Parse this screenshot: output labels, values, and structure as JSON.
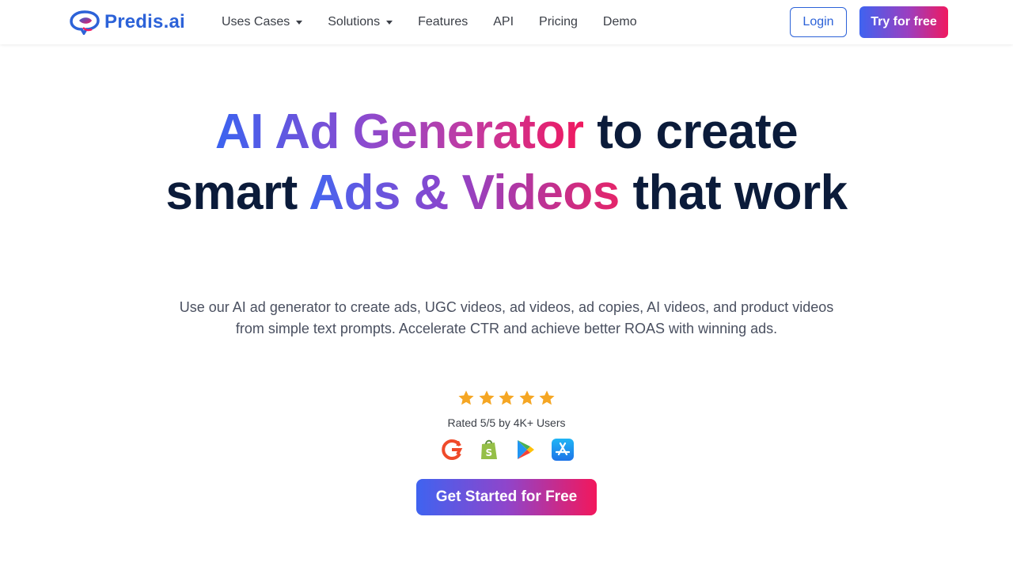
{
  "brand": {
    "name": "Predis.ai",
    "logo_icon": "speech-bubble-logo-icon",
    "color": "#2c62d8"
  },
  "nav": {
    "items": [
      {
        "label": "Uses Cases",
        "dropdown": true
      },
      {
        "label": "Solutions",
        "dropdown": true
      },
      {
        "label": "Features",
        "dropdown": false
      },
      {
        "label": "API",
        "dropdown": false
      },
      {
        "label": "Pricing",
        "dropdown": false
      },
      {
        "label": "Demo",
        "dropdown": false
      }
    ],
    "login_label": "Login",
    "try_label": "Try for free"
  },
  "hero": {
    "title_part1": "AI Ad Generator",
    "title_part2": " to create smart ",
    "title_part3": "Ads & Videos",
    "title_part4": " that work",
    "subtitle_line1": "Use our AI ad generator to create ads, UGC videos, ad videos, ad copies, AI videos, and product videos",
    "subtitle_line2": "from simple text prompts. Accelerate CTR and achieve better ROAS with winning ads."
  },
  "rating": {
    "stars": 5,
    "max_stars": 5,
    "star_color": "#f5a623",
    "text": "Rated 5/5 by 4K+ Users",
    "platforms": [
      "g2-icon",
      "shopify-icon",
      "google-play-icon",
      "app-store-icon"
    ]
  },
  "cta": {
    "label": "Get Started for Free"
  },
  "colors": {
    "gradient_start": "#3f63f0",
    "gradient_mid": "#9b3fc0",
    "gradient_end": "#f0195f",
    "heading": "#0b1b3a"
  }
}
